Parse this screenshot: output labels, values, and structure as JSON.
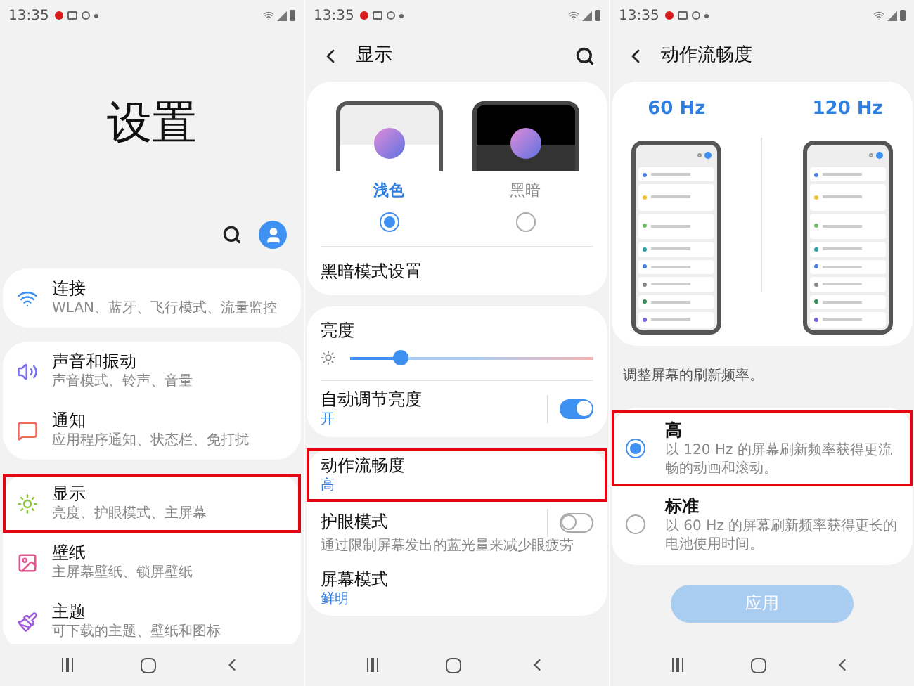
{
  "settings_screen": {
    "status_bar": {
      "time": "13:35"
    },
    "title": "设置",
    "groups": [
      [
        {
          "kind": "wifi",
          "title": "连接",
          "subtitle": "WLAN、蓝牙、飞行模式、流量监控",
          "highlighted": false
        }
      ],
      [
        {
          "kind": "sound",
          "title": "声音和振动",
          "subtitle": "声音模式、铃声、音量",
          "highlighted": false
        },
        {
          "kind": "notification",
          "title": "通知",
          "subtitle": "应用程序通知、状态栏、免打扰",
          "highlighted": false
        }
      ],
      [
        {
          "kind": "display",
          "title": "显示",
          "subtitle": "亮度、护眼模式、主屏幕",
          "highlighted": true
        },
        {
          "kind": "wallpaper",
          "title": "壁纸",
          "subtitle": "主屏幕壁纸、锁屏壁纸",
          "highlighted": false
        },
        {
          "kind": "theme",
          "title": "主题",
          "subtitle": "可下载的主题、壁纸和图标",
          "highlighted": false
        }
      ]
    ]
  },
  "display_screen": {
    "status_bar": {
      "time": "13:35"
    },
    "title": "显示",
    "themes": [
      {
        "kind": "light",
        "label": "浅色",
        "selected": true
      },
      {
        "kind": "dark",
        "label": "黑暗",
        "selected": false
      }
    ],
    "dark_mode_settings": "黑暗模式设置",
    "brightness": {
      "label": "亮度",
      "level": 0.21
    },
    "auto_brightness": {
      "title": "自动调节亮度",
      "value": "开",
      "on": true
    },
    "rows": [
      {
        "kind": "value",
        "title": "动作流畅度",
        "value": "高",
        "highlighted": true
      },
      {
        "kind": "toggle",
        "title": "护眼模式",
        "description": "通过限制屏幕发出的蓝光量来减少眼疲劳",
        "on": false,
        "highlighted": false
      },
      {
        "kind": "value",
        "title": "屏幕模式",
        "value": "鲜明",
        "highlighted": false
      }
    ]
  },
  "motion_screen": {
    "status_bar": {
      "time": "13:35"
    },
    "title": "动作流畅度",
    "rates": [
      "60 Hz",
      "120 Hz"
    ],
    "hint": "调整屏幕的刷新频率。",
    "options": [
      {
        "title": "高",
        "description": "以 120 Hz 的屏幕刷新频率获得更流畅的动画和滚动。",
        "selected": true,
        "highlighted": true
      },
      {
        "title": "标准",
        "description": "以 60 Hz 的屏幕刷新频率获得更长的电池使用时间。",
        "selected": false,
        "highlighted": false
      }
    ],
    "apply_button": {
      "label": "应用",
      "disabled": true
    }
  }
}
